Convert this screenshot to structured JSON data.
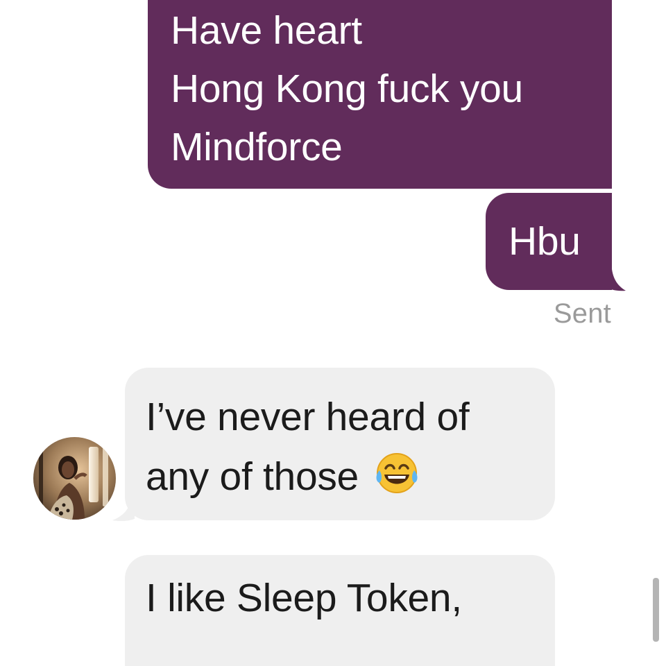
{
  "thread": {
    "messages": [
      {
        "direction": "sent",
        "lines": [
          "Have heart",
          "Hong Kong fuck you",
          "Mindforce"
        ]
      },
      {
        "direction": "sent",
        "text": "Hbu",
        "status": "Sent"
      },
      {
        "direction": "received",
        "lines": [
          "I’ve never heard of",
          "any of those"
        ],
        "emoji": "face-with-tears-of-joy",
        "sender_avatar": "profile-photo"
      },
      {
        "direction": "received",
        "text": "I like Sleep Token,"
      }
    ]
  },
  "colors": {
    "sent_bubble": "#612c5b",
    "received_bubble": "#efefef",
    "status_text": "#9a9a9a"
  }
}
